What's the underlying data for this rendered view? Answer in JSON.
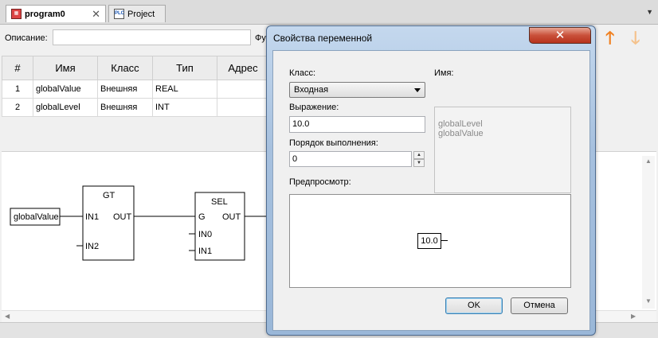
{
  "tabs": [
    {
      "label": "program0",
      "icon": "fbd-program-icon",
      "close": "✕",
      "active": true
    },
    {
      "label": "Project",
      "icon": "plc-project-icon",
      "badge": "PLC"
    }
  ],
  "tab_menu": "▼",
  "header": {
    "description_label": "Описание:",
    "description_value": "",
    "function_label": "Фу",
    "move_up_icon": "arrow-up-icon",
    "move_down_icon": "arrow-down-icon"
  },
  "variables": {
    "columns": [
      "#",
      "Имя",
      "Класс",
      "Тип",
      "Адрес"
    ],
    "rows": [
      [
        "1",
        "globalValue",
        "Внешняя",
        "REAL",
        ""
      ],
      [
        "2",
        "globalLevel",
        "Внешняя",
        "INT",
        ""
      ]
    ]
  },
  "diagram": {
    "input_variable": "globalValue",
    "blocks": [
      {
        "name": "GT",
        "inputs": [
          "IN1",
          "IN2"
        ],
        "output": "OUT"
      },
      {
        "name": "SEL",
        "inputs": [
          "G",
          "IN0",
          "IN1"
        ],
        "output": "OUT"
      }
    ]
  },
  "dialog": {
    "title": "Свойства переменной",
    "close_label": "✕",
    "class_label": "Класс:",
    "class_value": "Входная",
    "name_label": "Имя:",
    "names": [
      "globalLevel",
      "globalValue"
    ],
    "expression_label": "Выражение:",
    "expression_value": "10.0",
    "order_label": "Порядок выполнения:",
    "order_value": "0",
    "preview_label": "Предпросмотр:",
    "preview_value": "10.0",
    "ok_label": "OK",
    "cancel_label": "Отмена"
  },
  "colors": {
    "accent_arrow": "#f08020",
    "dialog_frame": "#a6c0de",
    "close_button": "#c9503a"
  }
}
